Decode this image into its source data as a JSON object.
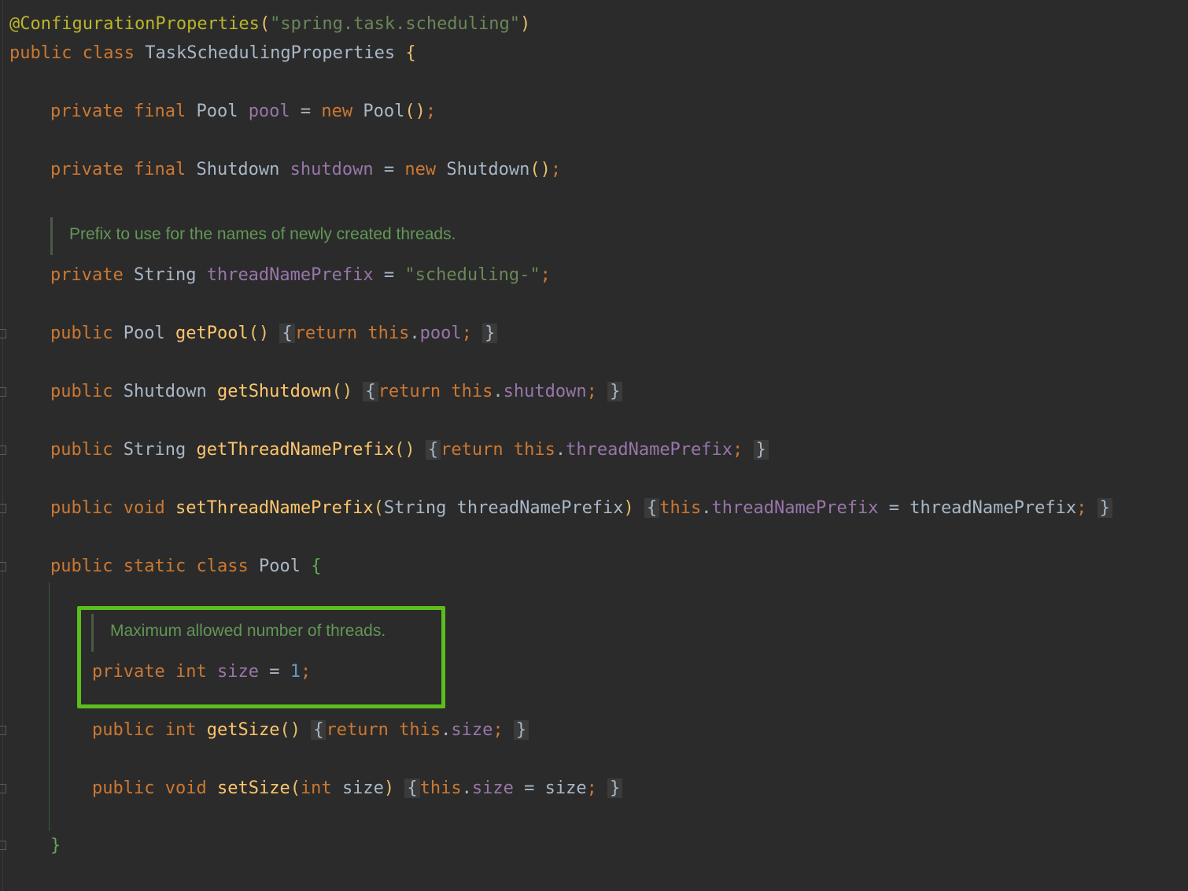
{
  "code": {
    "annotation": {
      "name": "@ConfigurationProperties",
      "open": "(",
      "value": "\"spring.task.scheduling\"",
      "close": ")"
    },
    "class_decl": {
      "kw1": "public",
      "kw2": "class",
      "name": "TaskSchedulingProperties",
      "brace": "{"
    },
    "pool_field": {
      "kw1": "private",
      "kw2": "final",
      "type": "Pool",
      "name": "pool",
      "eq": "=",
      "kw3": "new",
      "ctor": "Pool",
      "parens": "()",
      "semi": ";"
    },
    "shutdown_field": {
      "kw1": "private",
      "kw2": "final",
      "type": "Shutdown",
      "name": "shutdown",
      "eq": "=",
      "kw3": "new",
      "ctor": "Shutdown",
      "parens": "()",
      "semi": ";"
    },
    "prefix_doc": "Prefix to use for the names of newly created threads.",
    "prefix_field": {
      "kw1": "private",
      "type": "String",
      "name": "threadNamePrefix",
      "eq": "=",
      "value": "\"scheduling-\"",
      "semi": ";"
    },
    "get_pool": {
      "kw1": "public",
      "type": "Pool",
      "name": "getPool",
      "parens": "()",
      "body_open": "{",
      "ret": "return",
      "this": "this",
      "dot": ".",
      "field": "pool",
      "semi": ";",
      "body_close": "}"
    },
    "get_shutdown": {
      "kw1": "public",
      "type": "Shutdown",
      "name": "getShutdown",
      "parens": "()",
      "body_open": "{",
      "ret": "return",
      "this": "this",
      "dot": ".",
      "field": "shutdown",
      "semi": ";",
      "body_close": "}"
    },
    "get_prefix": {
      "kw1": "public",
      "type": "String",
      "name": "getThreadNamePrefix",
      "parens": "()",
      "body_open": "{",
      "ret": "return",
      "this": "this",
      "dot": ".",
      "field": "threadNamePrefix",
      "semi": ";",
      "body_close": "}"
    },
    "set_prefix": {
      "kw1": "public",
      "kw2": "void",
      "name": "setThreadNamePrefix",
      "p_open": "(",
      "ptype": "String",
      "pname": "threadNamePrefix",
      "p_close": ")",
      "body_open": "{",
      "this": "this",
      "dot": ".",
      "field": "threadNamePrefix",
      "eq": "=",
      "value": "threadNamePrefix",
      "semi": ";",
      "body_close": "}"
    },
    "pool_class": {
      "kw1": "public",
      "kw2": "static",
      "kw3": "class",
      "name": "Pool",
      "brace": "{"
    },
    "size_doc": "Maximum allowed number of threads.",
    "size_field": {
      "kw1": "private",
      "kw2": "int",
      "name": "size",
      "eq": "=",
      "value": "1",
      "semi": ";"
    },
    "get_size": {
      "kw1": "public",
      "kw2": "int",
      "name": "getSize",
      "parens": "()",
      "body_open": "{",
      "ret": "return",
      "this": "this",
      "dot": ".",
      "field": "size",
      "semi": ";",
      "body_close": "}"
    },
    "set_size": {
      "kw1": "public",
      "kw2": "void",
      "name": "setSize",
      "p_open": "(",
      "ptype": "int",
      "pname": "size",
      "p_close": ")",
      "body_open": "{",
      "this": "this",
      "dot": ".",
      "field": "size",
      "eq": "=",
      "value": "size",
      "semi": ";",
      "body_close": "}"
    },
    "pool_close": "}"
  },
  "colors": {
    "background": "#2b2b2b",
    "keyword": "#cc7832",
    "field": "#9876aa",
    "method": "#ffc66d",
    "string": "#6a8759",
    "number": "#6897bb",
    "annotation": "#bbb529",
    "doc_comment": "#629755",
    "highlight_box": "#5cbd1e"
  }
}
